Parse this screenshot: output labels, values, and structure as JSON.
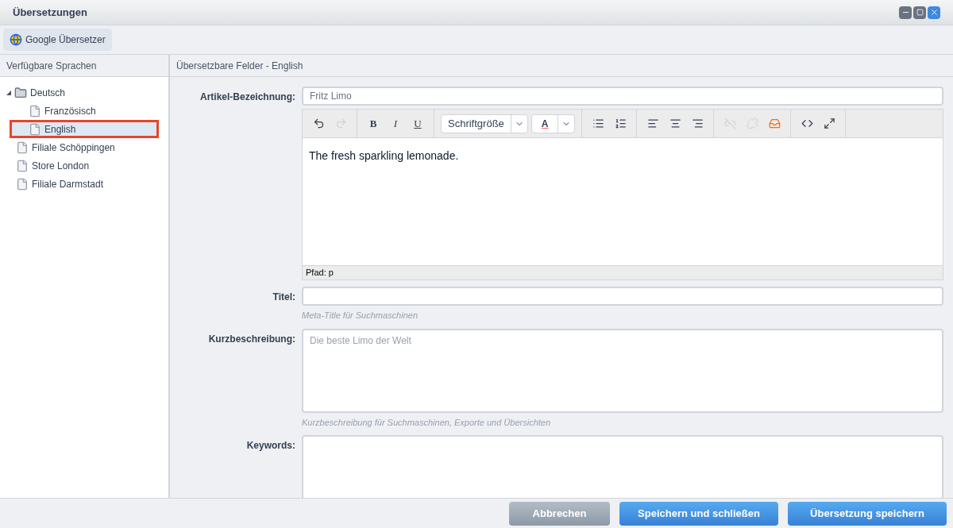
{
  "window": {
    "title": "Übersetzungen"
  },
  "toolbar": {
    "button": "Google Übersetzer"
  },
  "left_panel": {
    "title": "Verfügbare Sprachen",
    "tree": [
      {
        "label": "Deutsch",
        "kind": "folder",
        "expanded": true,
        "selected": false,
        "children": [
          {
            "label": "Französisch",
            "kind": "page",
            "selected": false
          },
          {
            "label": "English",
            "kind": "page",
            "selected": true
          }
        ]
      },
      {
        "label": "Filiale Schöppingen",
        "kind": "page",
        "selected": false
      },
      {
        "label": "Store London",
        "kind": "page",
        "selected": false
      },
      {
        "label": "Filiale Darmstadt",
        "kind": "page",
        "selected": false
      }
    ]
  },
  "right_panel": {
    "title": "Übersetzbare Felder - English",
    "fields": [
      {
        "kind": "input",
        "label": "Artikel-Bezeichnung:",
        "value": "Fritz Limo"
      },
      {
        "kind": "editor",
        "toolbar": [
          [
            {
              "kind": "undo",
              "disabled": false
            },
            {
              "kind": "redo",
              "disabled": true
            }
          ],
          [
            {
              "kind": "bold",
              "text": "B",
              "disabled": false
            },
            {
              "kind": "italic",
              "text": "I",
              "disabled": false
            },
            {
              "kind": "underline",
              "text": "U",
              "disabled": false
            }
          ],
          [
            {
              "kind": "select",
              "text": "Schriftgröße",
              "disabled": false
            },
            {
              "kind": "color",
              "text": "A",
              "disabled": false
            }
          ],
          [
            {
              "kind": "bullets",
              "disabled": false
            },
            {
              "kind": "numbers",
              "disabled": false
            }
          ],
          [
            {
              "kind": "align-left",
              "disabled": false
            },
            {
              "kind": "align-center",
              "disabled": false
            },
            {
              "kind": "align-right",
              "disabled": false
            }
          ],
          [
            {
              "kind": "link",
              "disabled": true
            },
            {
              "kind": "unlink",
              "disabled": true
            },
            {
              "kind": "media",
              "disabled": false
            }
          ],
          [
            {
              "kind": "code",
              "disabled": false
            },
            {
              "kind": "fullscreen",
              "disabled": false
            }
          ]
        ],
        "content": "The fresh sparkling lemonade.",
        "path": "Pfad: p"
      },
      {
        "kind": "input",
        "label": "Titel:",
        "hint": "Meta-Title für Suchmaschinen"
      },
      {
        "kind": "textarea",
        "label": "Kurzbeschreibung:",
        "placeholder": "Die beste Limo der Welt",
        "hint": "Kurzbeschreibung für Suchmaschinen, Exporte und Übersichten"
      },
      {
        "kind": "textarea",
        "label": "Keywords:"
      }
    ]
  },
  "footer": {
    "buttons": [
      {
        "label": "Abbrechen",
        "kind": "secondary"
      },
      {
        "label": "Speichern und schließen",
        "kind": "primary"
      },
      {
        "label": "Übersetzung speichern",
        "kind": "primary"
      }
    ]
  }
}
